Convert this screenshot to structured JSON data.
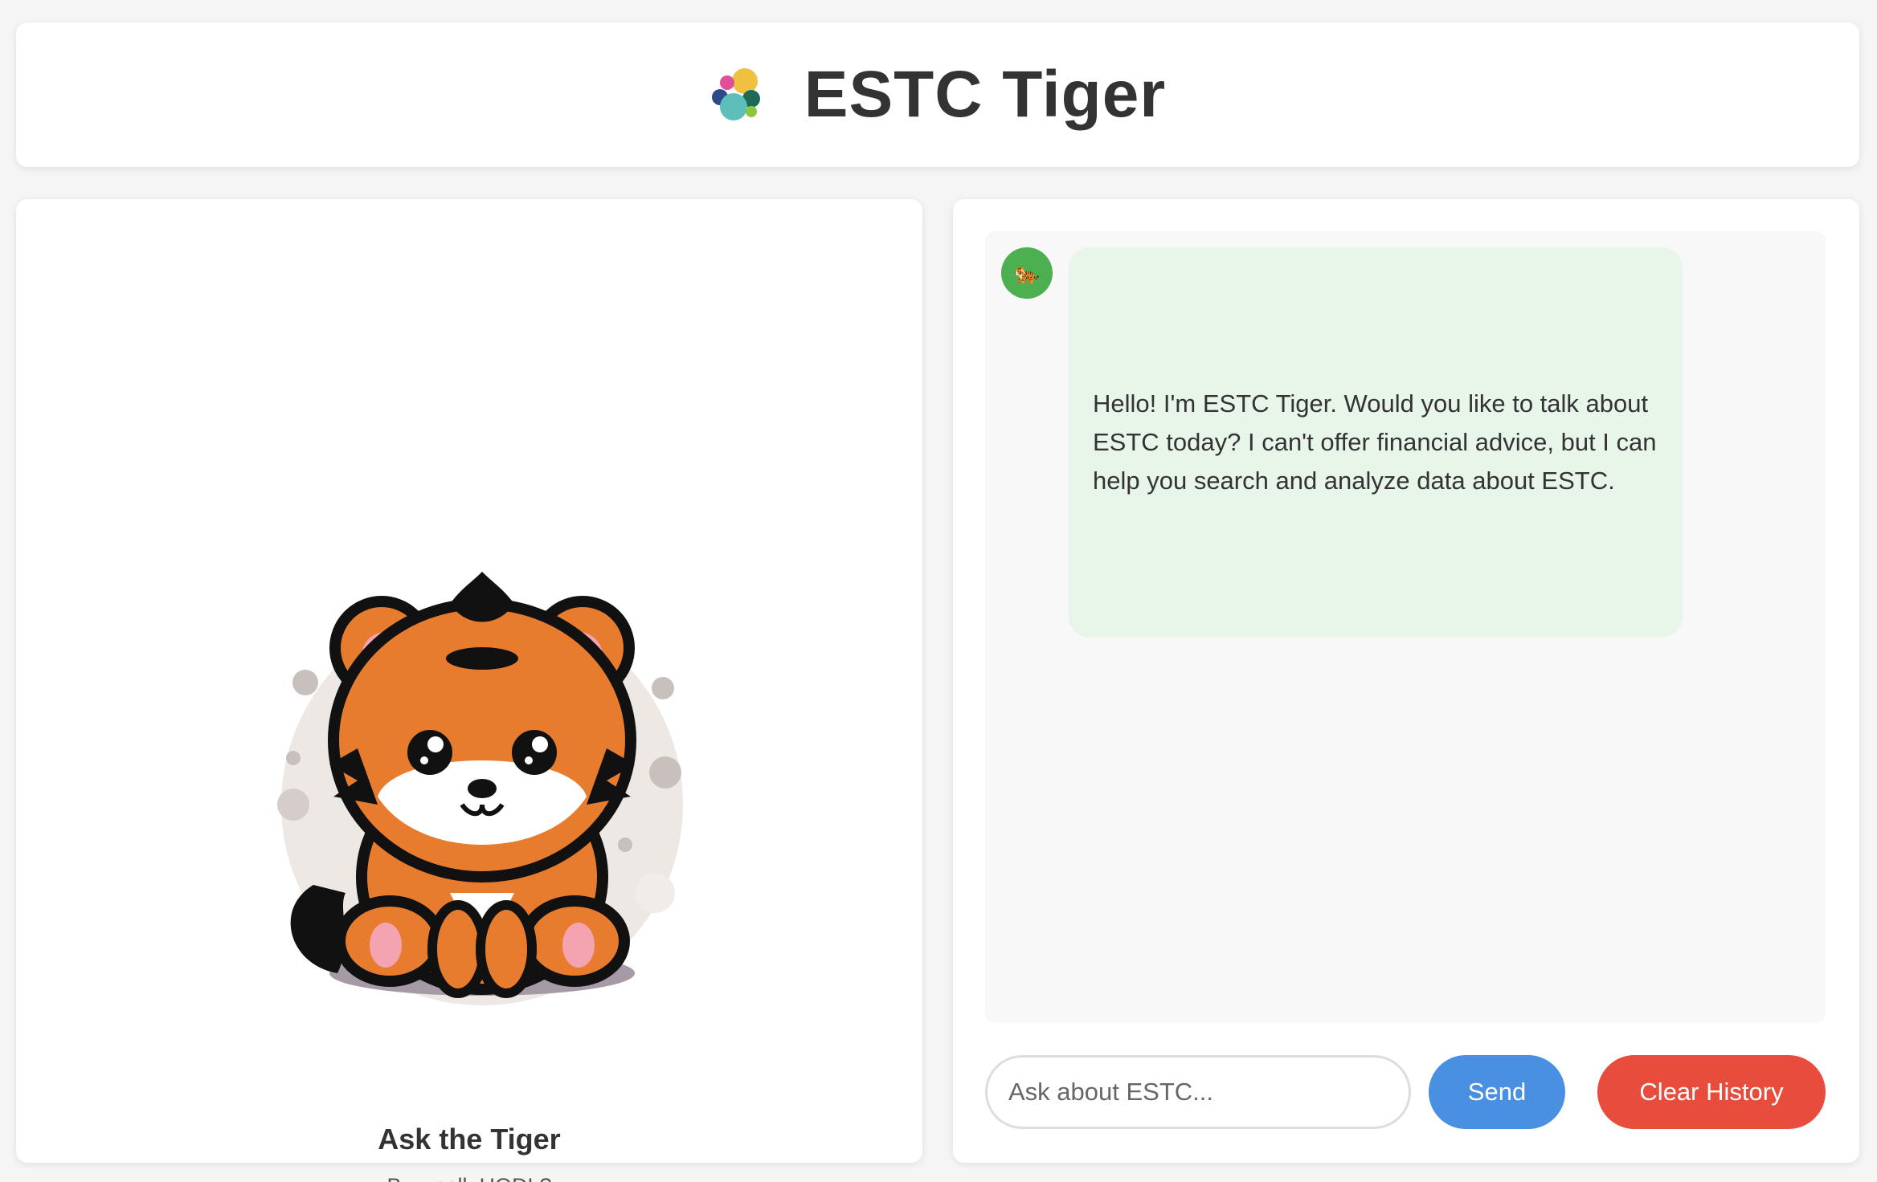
{
  "header": {
    "title": "ESTC Tiger",
    "logo_icon": "elastic-logo-icon"
  },
  "left_panel": {
    "image_icon": "tiger-mascot-icon",
    "title": "Ask the Tiger",
    "subtitle": "Buy, sell, HODL?"
  },
  "chat": {
    "avatar_icon": "tiger-icon",
    "avatar_glyph": "🐅",
    "messages": [
      {
        "role": "bot",
        "text": "Hello! I'm ESTC Tiger. Would you like to talk about ESTC today? I can't offer financial advice, but I can help you search and analyze data about ESTC."
      }
    ],
    "input_placeholder": "Ask about ESTC...",
    "input_value": "",
    "send_label": "Send",
    "clear_label": "Clear History"
  },
  "colors": {
    "background": "#f5f5f5",
    "card": "#ffffff",
    "bubble": "#e8f5e9",
    "avatar": "#4caf50",
    "send": "#4a90e2",
    "clear": "#e74c3c"
  }
}
